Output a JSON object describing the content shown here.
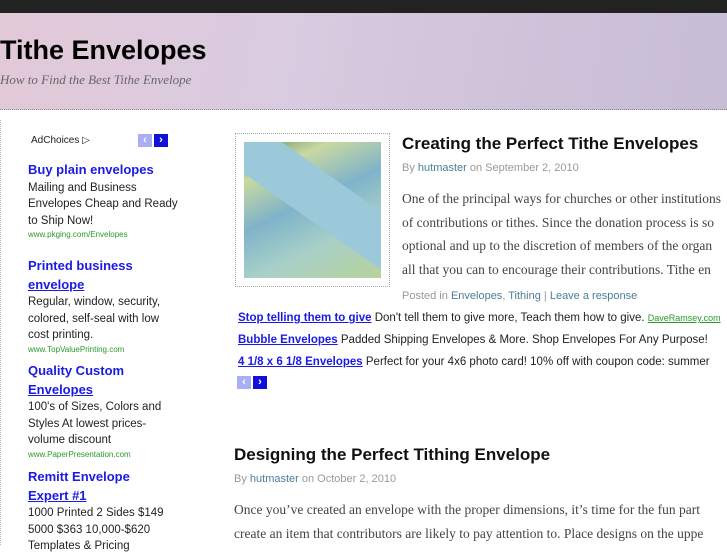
{
  "site": {
    "title": "Tithe Envelopes",
    "tagline": "How to Find the Best Tithe Envelope"
  },
  "sidebar": {
    "adchoices": "AdChoices ▷",
    "ads": [
      {
        "title_a": "Buy plain envelopes",
        "title_b": "",
        "desc": "Mailing and Business Envelopes Cheap and Ready to Ship Now!",
        "url": "www.pkging.com/Envelopes"
      },
      {
        "title_a": "Printed business",
        "title_b": "envelope",
        "desc": "Regular, window, security, colored, self-seal with low cost printing.",
        "url": "www.TopValuePrinting.com"
      },
      {
        "title_a": "Quality Custom",
        "title_b": "Envelopes",
        "desc": "100's of Sizes, Colors and Styles At lowest prices-volume discount",
        "url": "www.PaperPresentation.com"
      },
      {
        "title_a": "Remitt Envelope",
        "title_b": "Expert #1",
        "desc": "1000 Printed 2 Sides $149 5000 $363 10,000-$620 Templates & Pricing",
        "url": ""
      }
    ]
  },
  "posts": [
    {
      "title": "Creating the Perfect Tithe Envelopes",
      "by": "By",
      "author": "hutmaster",
      "on": "on September 2, 2010",
      "lines": [
        "One of the principal ways for churches or other institutions",
        "of contributions or tithes. Since the donation process is so",
        "optional and up to the discretion of members of the organ",
        "all that you can to encourage their contributions. Tithe en"
      ],
      "posted_in": "Posted in",
      "cat1": "Envelopes",
      "cat2": "Tithing",
      "sep": "|",
      "respond": "Leave a response"
    },
    {
      "title": "Designing the Perfect Tithing Envelope",
      "by": "By",
      "author": "hutmaster",
      "on": "on October 2, 2010",
      "lines": [
        "Once you’ve created an envelope with the proper dimensions, it’s time for the fun part",
        "create an item that contributors are likely to pay attention to. Place designs on the uppe"
      ]
    }
  ],
  "link_ads": [
    {
      "title": "Stop telling them to give",
      "desc": "Don't tell them to give more, Teach them how to give.",
      "url": "DaveRamsey.com"
    },
    {
      "title": "Bubble Envelopes",
      "desc": "Padded Shipping Envelopes & More. Shop Envelopes For Any Purpose!",
      "url": ""
    },
    {
      "title": "4 1/8 x 6 1/8 Envelopes",
      "desc": "Perfect for your 4x6 photo card! 10% off with coupon code: summer",
      "url": ""
    }
  ],
  "nav": {
    "prev": "‹",
    "next": "›"
  }
}
